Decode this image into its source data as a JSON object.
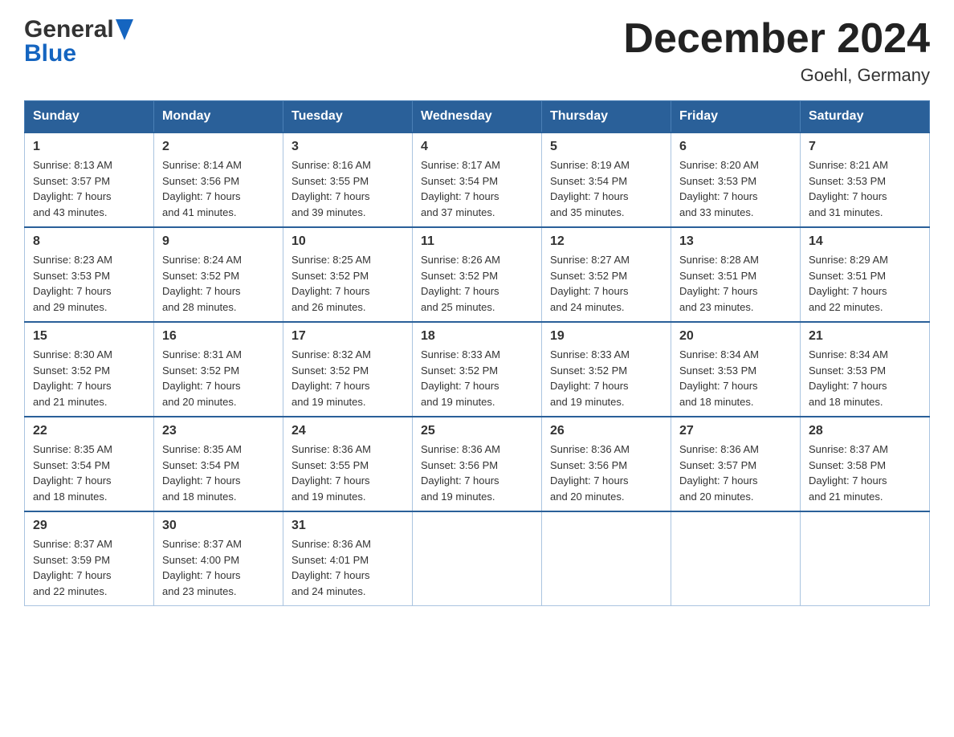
{
  "header": {
    "logo_general": "General",
    "logo_blue": "Blue",
    "title": "December 2024",
    "subtitle": "Goehl, Germany"
  },
  "calendar": {
    "headers": [
      "Sunday",
      "Monday",
      "Tuesday",
      "Wednesday",
      "Thursday",
      "Friday",
      "Saturday"
    ],
    "weeks": [
      [
        {
          "day": "1",
          "sunrise": "8:13 AM",
          "sunset": "3:57 PM",
          "daylight": "7 hours and 43 minutes."
        },
        {
          "day": "2",
          "sunrise": "8:14 AM",
          "sunset": "3:56 PM",
          "daylight": "7 hours and 41 minutes."
        },
        {
          "day": "3",
          "sunrise": "8:16 AM",
          "sunset": "3:55 PM",
          "daylight": "7 hours and 39 minutes."
        },
        {
          "day": "4",
          "sunrise": "8:17 AM",
          "sunset": "3:54 PM",
          "daylight": "7 hours and 37 minutes."
        },
        {
          "day": "5",
          "sunrise": "8:19 AM",
          "sunset": "3:54 PM",
          "daylight": "7 hours and 35 minutes."
        },
        {
          "day": "6",
          "sunrise": "8:20 AM",
          "sunset": "3:53 PM",
          "daylight": "7 hours and 33 minutes."
        },
        {
          "day": "7",
          "sunrise": "8:21 AM",
          "sunset": "3:53 PM",
          "daylight": "7 hours and 31 minutes."
        }
      ],
      [
        {
          "day": "8",
          "sunrise": "8:23 AM",
          "sunset": "3:53 PM",
          "daylight": "7 hours and 29 minutes."
        },
        {
          "day": "9",
          "sunrise": "8:24 AM",
          "sunset": "3:52 PM",
          "daylight": "7 hours and 28 minutes."
        },
        {
          "day": "10",
          "sunrise": "8:25 AM",
          "sunset": "3:52 PM",
          "daylight": "7 hours and 26 minutes."
        },
        {
          "day": "11",
          "sunrise": "8:26 AM",
          "sunset": "3:52 PM",
          "daylight": "7 hours and 25 minutes."
        },
        {
          "day": "12",
          "sunrise": "8:27 AM",
          "sunset": "3:52 PM",
          "daylight": "7 hours and 24 minutes."
        },
        {
          "day": "13",
          "sunrise": "8:28 AM",
          "sunset": "3:51 PM",
          "daylight": "7 hours and 23 minutes."
        },
        {
          "day": "14",
          "sunrise": "8:29 AM",
          "sunset": "3:51 PM",
          "daylight": "7 hours and 22 minutes."
        }
      ],
      [
        {
          "day": "15",
          "sunrise": "8:30 AM",
          "sunset": "3:52 PM",
          "daylight": "7 hours and 21 minutes."
        },
        {
          "day": "16",
          "sunrise": "8:31 AM",
          "sunset": "3:52 PM",
          "daylight": "7 hours and 20 minutes."
        },
        {
          "day": "17",
          "sunrise": "8:32 AM",
          "sunset": "3:52 PM",
          "daylight": "7 hours and 19 minutes."
        },
        {
          "day": "18",
          "sunrise": "8:33 AM",
          "sunset": "3:52 PM",
          "daylight": "7 hours and 19 minutes."
        },
        {
          "day": "19",
          "sunrise": "8:33 AM",
          "sunset": "3:52 PM",
          "daylight": "7 hours and 19 minutes."
        },
        {
          "day": "20",
          "sunrise": "8:34 AM",
          "sunset": "3:53 PM",
          "daylight": "7 hours and 18 minutes."
        },
        {
          "day": "21",
          "sunrise": "8:34 AM",
          "sunset": "3:53 PM",
          "daylight": "7 hours and 18 minutes."
        }
      ],
      [
        {
          "day": "22",
          "sunrise": "8:35 AM",
          "sunset": "3:54 PM",
          "daylight": "7 hours and 18 minutes."
        },
        {
          "day": "23",
          "sunrise": "8:35 AM",
          "sunset": "3:54 PM",
          "daylight": "7 hours and 18 minutes."
        },
        {
          "day": "24",
          "sunrise": "8:36 AM",
          "sunset": "3:55 PM",
          "daylight": "7 hours and 19 minutes."
        },
        {
          "day": "25",
          "sunrise": "8:36 AM",
          "sunset": "3:56 PM",
          "daylight": "7 hours and 19 minutes."
        },
        {
          "day": "26",
          "sunrise": "8:36 AM",
          "sunset": "3:56 PM",
          "daylight": "7 hours and 20 minutes."
        },
        {
          "day": "27",
          "sunrise": "8:36 AM",
          "sunset": "3:57 PM",
          "daylight": "7 hours and 20 minutes."
        },
        {
          "day": "28",
          "sunrise": "8:37 AM",
          "sunset": "3:58 PM",
          "daylight": "7 hours and 21 minutes."
        }
      ],
      [
        {
          "day": "29",
          "sunrise": "8:37 AM",
          "sunset": "3:59 PM",
          "daylight": "7 hours and 22 minutes."
        },
        {
          "day": "30",
          "sunrise": "8:37 AM",
          "sunset": "4:00 PM",
          "daylight": "7 hours and 23 minutes."
        },
        {
          "day": "31",
          "sunrise": "8:36 AM",
          "sunset": "4:01 PM",
          "daylight": "7 hours and 24 minutes."
        },
        null,
        null,
        null,
        null
      ]
    ],
    "sunrise_label": "Sunrise:",
    "sunset_label": "Sunset:",
    "daylight_label": "Daylight:"
  }
}
